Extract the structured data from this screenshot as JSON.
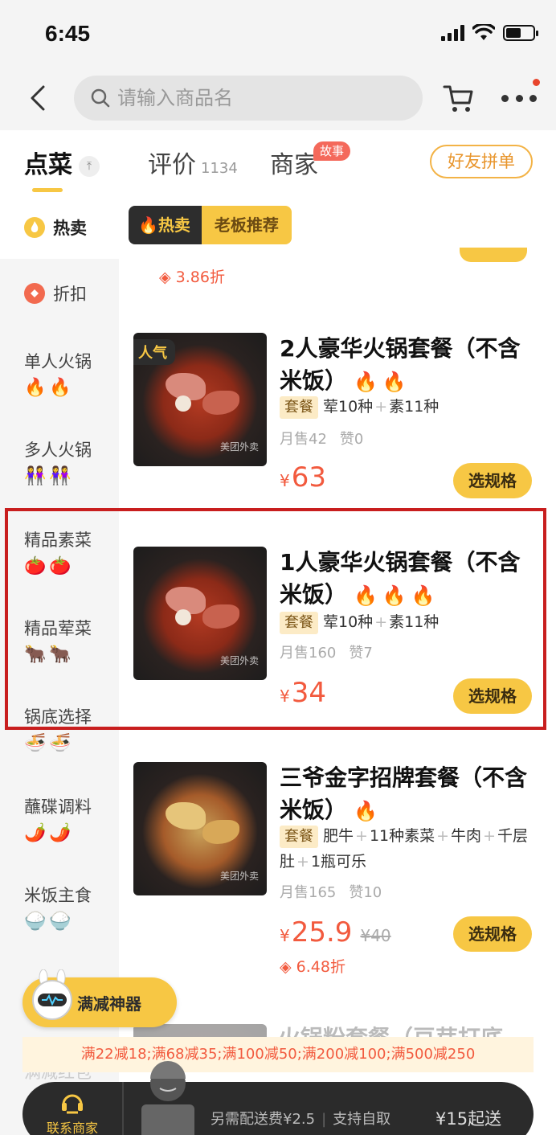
{
  "status": {
    "time": "6:45"
  },
  "search": {
    "placeholder": "请输入商品名"
  },
  "tabs": {
    "dishes": "点菜",
    "reviews": "评价",
    "reviews_count": "1134",
    "merchant": "商家",
    "story_badge": "故事",
    "group_order": "好友拼单"
  },
  "sidebar": {
    "items": [
      {
        "label": "热卖",
        "icon": "flame-icon"
      },
      {
        "label": "折扣",
        "icon": "discount-icon"
      },
      {
        "label": "单人火锅",
        "emoji": "🔥🔥"
      },
      {
        "label": "多人火锅",
        "emoji": "👭👭"
      },
      {
        "label": "精品素菜",
        "emoji": "🍅🍅"
      },
      {
        "label": "精品荤菜",
        "emoji": "🐂🐂"
      },
      {
        "label": "锅底选择",
        "emoji": "🍜🍜"
      },
      {
        "label": "蘸碟调料",
        "emoji": "🌶️🌶️"
      },
      {
        "label": "米饭主食",
        "emoji": "🍚🍚"
      },
      {
        "label": "满减红包"
      }
    ]
  },
  "category": {
    "tag_left": "热卖",
    "tag_right": "老板推荐"
  },
  "prev_item": {
    "discount": "3.86折"
  },
  "products": [
    {
      "popular_tag": "人气",
      "name": "2人豪华火锅套餐（不含米饭）",
      "fire": "🔥🔥",
      "set_tag": "套餐",
      "contents": [
        "荤10种",
        "素11种"
      ],
      "monthly_sales": "月售42",
      "likes": "赞0",
      "yen": "¥",
      "price": "63",
      "button": "选规格",
      "watermark": "美团外卖"
    },
    {
      "name": "1人豪华火锅套餐（不含米饭）",
      "fire": "🔥🔥🔥",
      "set_tag": "套餐",
      "contents": [
        "荤10种",
        "素11种"
      ],
      "monthly_sales": "月售160",
      "likes": "赞7",
      "yen": "¥",
      "price": "34",
      "button": "选规格",
      "watermark": "美团外卖"
    },
    {
      "name": "三爷金字招牌套餐（不含米饭）",
      "fire": "🔥",
      "set_tag": "套餐",
      "contents": [
        "肥牛",
        "11种素菜",
        "牛肉",
        "千层肚",
        "1瓶可乐"
      ],
      "monthly_sales": "月售165",
      "likes": "赞10",
      "yen": "¥",
      "price": "25.9",
      "original_price": "¥40",
      "discount": "6.48折",
      "button": "选规格",
      "watermark": "美团外卖"
    },
    {
      "name_partial": "火锅粉套餐（豆芽打底"
    }
  ],
  "promo": {
    "tool_label": "满减神器",
    "banner": "满22减18;满68减35;满100减50;满200减100;满500减250"
  },
  "bottom": {
    "contact": "联系商家",
    "delivery_fee": "另需配送费¥2.5",
    "self_pickup": "支持自取",
    "min_order": "¥15起送"
  },
  "colors": {
    "accent": "#f7c744",
    "price": "#f25a3e",
    "highlight": "#c81e1e"
  }
}
